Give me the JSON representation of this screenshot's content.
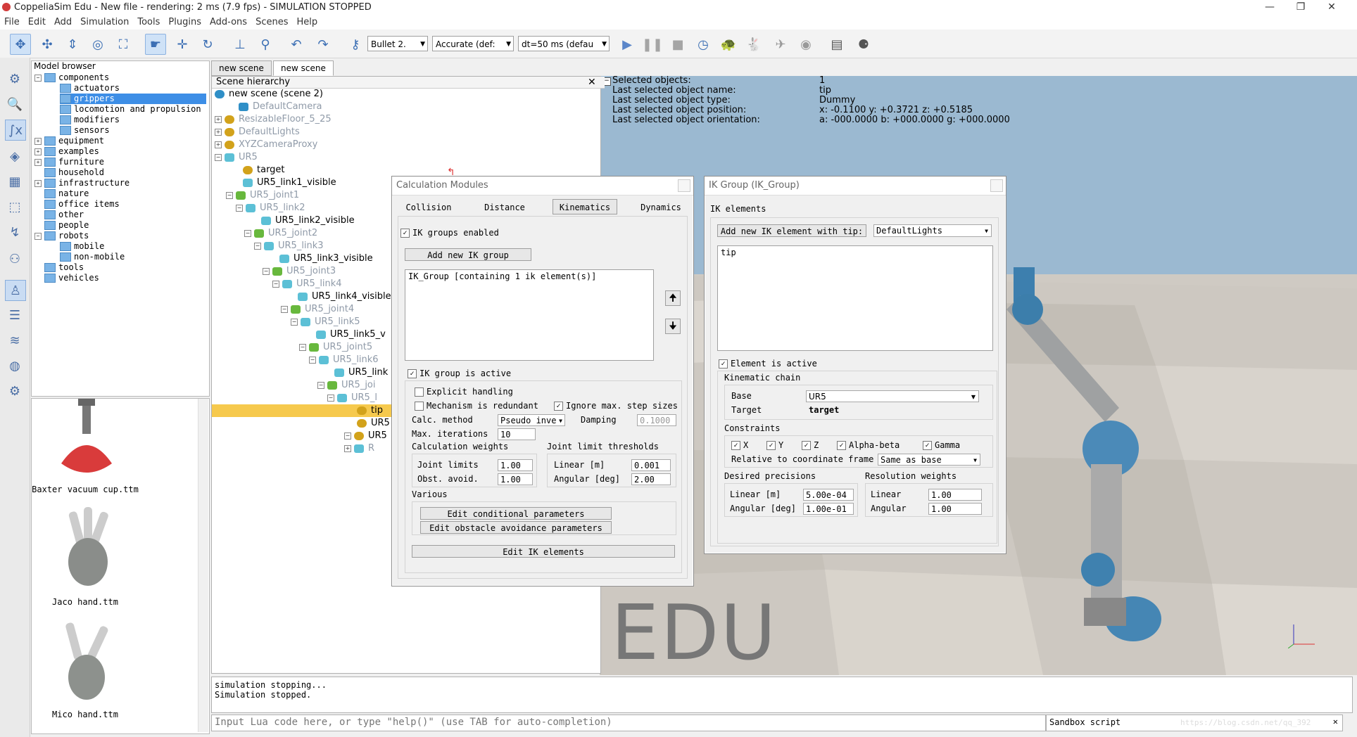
{
  "window": {
    "title": "CoppeliaSim Edu - New file - rendering: 2 ms (7.9 fps) - SIMULATION STOPPED"
  },
  "menu": [
    "File",
    "Edit",
    "Add",
    "Simulation",
    "Tools",
    "Plugins",
    "Add-ons",
    "Scenes",
    "Help"
  ],
  "toolbar": {
    "engine": "Bullet 2.",
    "accuracy": "Accurate (def:",
    "dt": "dt=50 ms (defau"
  },
  "model_browser": {
    "title": "Model browser",
    "tree": [
      "components",
      "actuators",
      "grippers",
      "locomotion and propulsion",
      "modifiers",
      "sensors",
      "equipment",
      "examples",
      "furniture",
      "household",
      "infrastructure",
      "nature",
      "office items",
      "other",
      "people",
      "robots",
      "mobile",
      "non-mobile",
      "tools",
      "vehicles"
    ],
    "thumbs": [
      "Baxter vacuum cup.ttm",
      "Jaco hand.ttm",
      "Mico hand.ttm"
    ]
  },
  "scene_tabs": [
    "new scene",
    "new scene"
  ],
  "scene_hierarchy": {
    "title": "Scene hierarchy",
    "rows": [
      "new scene (scene 2)",
      "DefaultCamera",
      "ResizableFloor_5_25",
      "DefaultLights",
      "XYZCameraProxy",
      "UR5",
      "target",
      "UR5_link1_visible",
      "UR5_joint1",
      "UR5_link2",
      "UR5_link2_visible",
      "UR5_joint2",
      "UR5_link3",
      "UR5_link3_visible",
      "UR5_joint3",
      "UR5_link4",
      "UR5_link4_visible",
      "UR5_joint4",
      "UR5_link5",
      "UR5_link5_v",
      "UR5_joint5",
      "UR5_link6",
      "UR5_link",
      "UR5_joi",
      "UR5_l",
      "tip",
      "UR5",
      "UR5",
      "R"
    ]
  },
  "info": {
    "labels": [
      "Selected objects:",
      "Last selected object name:",
      "Last selected object type:",
      "Last selected object position:",
      "Last selected object orientation:"
    ],
    "values": [
      "1",
      "tip",
      "Dummy",
      "x: -0.1100    y: +0.3721    z: +0.5185",
      "a: -000.0000    b: +000.0000    g: +000.0000"
    ]
  },
  "calc_modules": {
    "title": "Calculation Modules",
    "tabs": [
      "Collision",
      "Distance",
      "Kinematics",
      "Dynamics"
    ],
    "ik_groups_enabled": "IK groups enabled",
    "add_group": "Add new IK group",
    "group_list": "IK_Group [containing 1 ik element(s)]",
    "ik_group_active": "IK group is active",
    "explicit": "Explicit handling",
    "redundant": "Mechanism is redundant",
    "ignore_step": "Ignore max. step sizes",
    "calc_method_label": "Calc. method",
    "calc_method": "Pseudo inve",
    "damping_label": "Damping",
    "damping": "0.1000",
    "max_iter_label": "Max. iterations",
    "max_iter": "10",
    "calc_weights": "Calculation weights",
    "joint_limit_thr": "Joint limit thresholds",
    "joint_limits_label": "Joint limits",
    "joint_limits": "1.00",
    "obst_label": "Obst. avoid.",
    "obst": "1.00",
    "linear_m_label": "Linear [m]",
    "linear_m": "0.001",
    "angular_label": "Angular [deg]",
    "angular": "2.00",
    "various": "Various",
    "edit_cond": "Edit conditional parameters",
    "edit_obst": "Edit obstacle avoidance parameters",
    "edit_ik": "Edit IK elements"
  },
  "ik_group": {
    "title": "IK Group (IK_Group)",
    "ik_elements": "IK elements",
    "add_elem": "Add new IK element with tip:",
    "tip_select": "DefaultLights",
    "list": "tip",
    "elem_active": "Element is active",
    "kin_chain": "Kinematic chain",
    "base_label": "Base",
    "base": "UR5",
    "target_label": "Target",
    "target": "target",
    "constraints": "Constraints",
    "cons": [
      "X",
      "Y",
      "Z",
      "Alpha-beta",
      "Gamma"
    ],
    "rel_frame_label": "Relative to coordinate frame",
    "rel_frame": "Same as base",
    "desired_prec": "Desired precisions",
    "res_weights": "Resolution weights",
    "lin_label": "Linear [m]",
    "lin_val": "5.00e-04",
    "ang_label": "Angular [deg]",
    "ang_val": "1.00e-01",
    "w_lin_label": "Linear",
    "w_lin": "1.00",
    "w_ang_label": "Angular",
    "w_ang": "1.00"
  },
  "watermark": "EDU",
  "console": [
    "simulation stopping...",
    "Simulation stopped."
  ],
  "cmd_placeholder": "Input Lua code here, or type \"help()\" (use TAB for auto-completion)",
  "sandbox": "Sandbox script",
  "url_watermark": "https://blog.csdn.net/qq_392"
}
